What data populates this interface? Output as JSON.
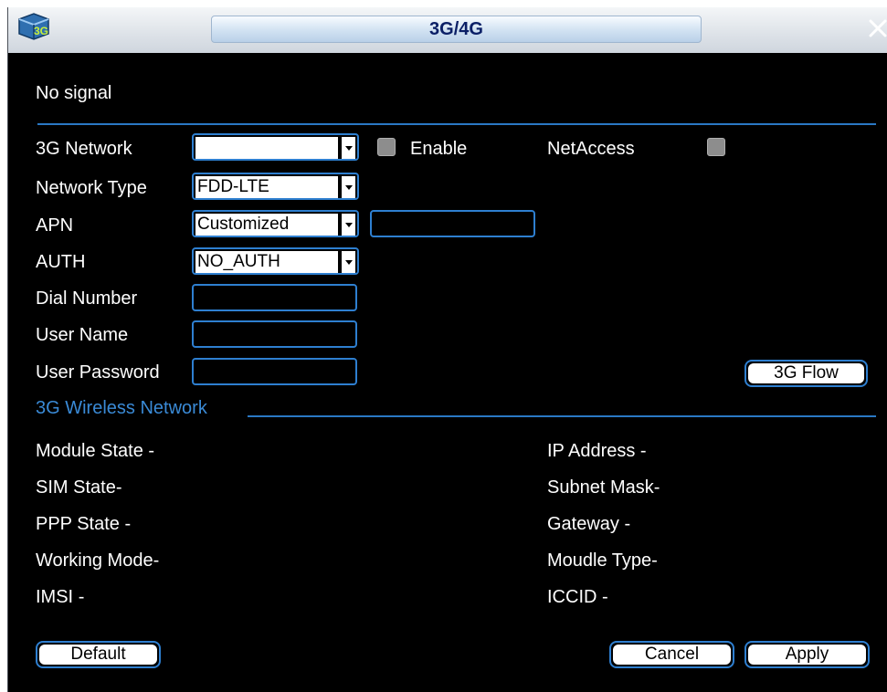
{
  "window": {
    "title": "3G/4G"
  },
  "status": {
    "signal": "No signal"
  },
  "form": {
    "network": {
      "label": "3G Network",
      "value": ""
    },
    "enable": {
      "label": "Enable",
      "checked": false
    },
    "net_access": {
      "label": "NetAccess",
      "checked": false
    },
    "network_type": {
      "label": "Network Type",
      "value": "FDD-LTE"
    },
    "apn": {
      "label": "APN",
      "value": "Customized",
      "custom_value": ""
    },
    "auth": {
      "label": "AUTH",
      "value": "NO_AUTH"
    },
    "dial_number": {
      "label": "Dial Number",
      "value": ""
    },
    "user_name": {
      "label": "User Name",
      "value": ""
    },
    "user_password": {
      "label": "User Password",
      "value": ""
    }
  },
  "buttons": {
    "flow": "3G Flow",
    "default": "Default",
    "cancel": "Cancel",
    "apply": "Apply"
  },
  "wireless": {
    "section_title": "3G Wireless Network",
    "left": [
      {
        "label": "Module State",
        "value": "-"
      },
      {
        "label": "SIM State",
        "value": "-"
      },
      {
        "label": "PPP State",
        "value": "-"
      },
      {
        "label": "Working Mode",
        "value": "-"
      },
      {
        "label": "IMSI",
        "value": "-"
      }
    ],
    "right": [
      {
        "label": "IP Address",
        "value": "-"
      },
      {
        "label": "Subnet Mask",
        "value": "-"
      },
      {
        "label": "Gateway",
        "value": "-"
      },
      {
        "label": "Moudle Type",
        "value": "-"
      },
      {
        "label": "ICCID",
        "value": "-"
      }
    ]
  },
  "colors": {
    "accent": "#2e7fd0",
    "section_text": "#3a8ad6",
    "background": "#000000"
  },
  "icons": {
    "app": "3g-signal-icon",
    "close": "close-icon"
  }
}
